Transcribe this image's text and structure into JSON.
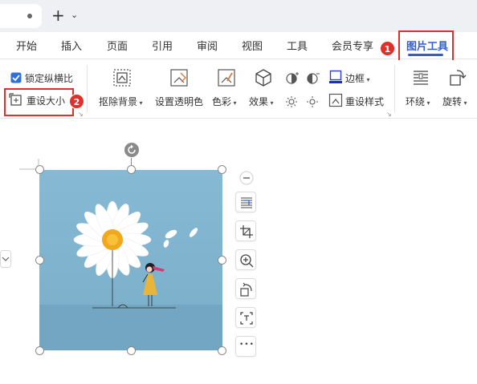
{
  "tabs": {
    "new_tab_symbol": "+",
    "new_tab_caret": "⌄"
  },
  "menu": {
    "items": [
      "开始",
      "插入",
      "页面",
      "引用",
      "审阅",
      "视图",
      "工具",
      "会员专享"
    ],
    "active": "图片工具"
  },
  "ribbon": {
    "lock_aspect_label": "锁定纵横比",
    "lock_aspect_checked": true,
    "reset_size_label": "重设大小",
    "remove_bg_label": "抠除背景",
    "set_transparent_label": "设置透明色",
    "color_label": "色彩",
    "effects_label": "效果",
    "border_label": "边框",
    "reset_style_label": "重设样式",
    "wrap_label": "环绕",
    "rotate_label": "旋转"
  },
  "annotations": {
    "badge1": "1",
    "badge2": "2",
    "highlight_color": "#e0302b"
  },
  "image": {
    "description_icon": "daisy-girl-illustration",
    "background_color": "#7fb3cd"
  },
  "floating_toolbar": {
    "collapse_symbol": "−",
    "more_symbol": "•••",
    "icons": [
      "wrap-text-icon",
      "crop-icon",
      "zoom-in-icon",
      "rotate-icon",
      "fit-icon",
      "more-icon"
    ]
  },
  "colors": {
    "accent": "#2f5dd6",
    "annotation_red": "#e0302b"
  }
}
